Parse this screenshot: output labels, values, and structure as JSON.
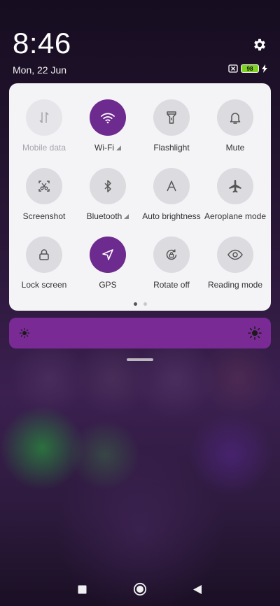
{
  "status_bar": {
    "time": "8:46",
    "date": "Mon, 22 Jun",
    "battery_level": "98",
    "icons": [
      "settings-icon",
      "no-sim-icon",
      "battery-icon",
      "charging-icon"
    ]
  },
  "quick_settings": {
    "tiles": [
      {
        "label": "Mobile data",
        "icon": "mobile-data-icon",
        "state": "disabled"
      },
      {
        "label": "Wi-Fi",
        "icon": "wifi-icon",
        "state": "active"
      },
      {
        "label": "Flashlight",
        "icon": "flashlight-icon",
        "state": "off"
      },
      {
        "label": "Mute",
        "icon": "bell-icon",
        "state": "off"
      },
      {
        "label": "Screenshot",
        "icon": "screenshot-icon",
        "state": "off"
      },
      {
        "label": "Bluetooth",
        "icon": "bluetooth-icon",
        "state": "off"
      },
      {
        "label": "Auto brightness",
        "icon": "auto-brightness-icon",
        "state": "off"
      },
      {
        "label": "Aeroplane mode",
        "icon": "airplane-icon",
        "state": "off"
      },
      {
        "label": "Lock screen",
        "icon": "lock-icon",
        "state": "off"
      },
      {
        "label": "GPS",
        "icon": "location-icon",
        "state": "active"
      },
      {
        "label": "Rotate off",
        "icon": "rotate-lock-icon",
        "state": "off"
      },
      {
        "label": "Reading mode",
        "icon": "eye-icon",
        "state": "off"
      }
    ],
    "page_count": 2,
    "current_page": 1
  },
  "brightness": {
    "level": 1.0,
    "low_icon": "brightness-low-icon",
    "high_icon": "brightness-high-icon"
  },
  "colors": {
    "accent": "#6d2a8f",
    "slider": "#7a2a94",
    "panel": "#f4f3f6",
    "tile_off": "#dcdbe0"
  },
  "nav_bar": {
    "icons": [
      "recents-icon",
      "home-icon",
      "back-icon"
    ]
  }
}
